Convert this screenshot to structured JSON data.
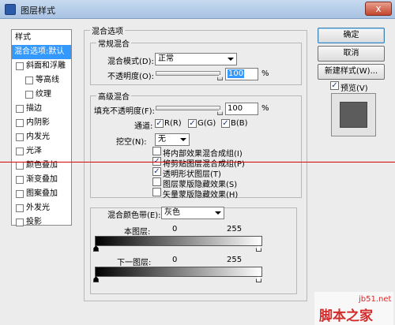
{
  "window": {
    "title": "图层样式",
    "close": "x"
  },
  "sidebar": {
    "header": "样式",
    "items": [
      {
        "label": "混合选项:默认",
        "has_checkbox": false,
        "selected": true
      },
      {
        "label": "斜面和浮雕",
        "has_checkbox": true
      },
      {
        "label": "等高线",
        "has_checkbox": true,
        "indent": true
      },
      {
        "label": "纹理",
        "has_checkbox": true,
        "indent": true
      },
      {
        "label": "描边",
        "has_checkbox": true
      },
      {
        "label": "内阴影",
        "has_checkbox": true
      },
      {
        "label": "内发光",
        "has_checkbox": true
      },
      {
        "label": "光泽",
        "has_checkbox": true
      },
      {
        "label": "颜色叠加",
        "has_checkbox": true
      },
      {
        "label": "渐变叠加",
        "has_checkbox": true
      },
      {
        "label": "图案叠加",
        "has_checkbox": true
      },
      {
        "label": "外发光",
        "has_checkbox": true
      },
      {
        "label": "投影",
        "has_checkbox": true
      }
    ]
  },
  "blend_options": {
    "title": "混合选项",
    "general": {
      "title": "常规混合",
      "blend_mode_label": "混合模式(D):",
      "blend_mode_value": "正常",
      "opacity_label": "不透明度(O):",
      "opacity_value": "100",
      "opacity_unit": "%"
    },
    "advanced": {
      "title": "高级混合",
      "fill_opacity_label": "填充不透明度(F):",
      "fill_opacity_value": "100",
      "fill_opacity_unit": "%",
      "channels_label": "通道:",
      "channel_r": "R(R)",
      "channel_g": "G(G)",
      "channel_b": "B(B)",
      "knockout_label": "挖空(N):",
      "knockout_value": "无",
      "options": [
        {
          "label": "将内部效果混合成组(I)",
          "checked": false
        },
        {
          "label": "将剪贴图层混合成组(P)",
          "checked": true
        },
        {
          "label": "透明形状图层(T)",
          "checked": true
        },
        {
          "label": "图层蒙版隐藏效果(S)",
          "checked": false
        },
        {
          "label": "矢量蒙版隐藏效果(H)",
          "checked": false
        }
      ]
    },
    "blend_if": {
      "label": "混合颜色带(E):",
      "value": "灰色",
      "this_layer_label": "本图层:",
      "this_layer_min": "0",
      "this_layer_max": "255",
      "underlying_label": "下一图层:",
      "underlying_min": "0",
      "underlying_max": "255"
    }
  },
  "buttons": {
    "ok": "确定",
    "cancel": "取消",
    "new_style": "新建样式(W)...",
    "preview_label": "预览(V)",
    "preview_checked": true
  },
  "watermark": {
    "site": "jb51.net",
    "name": "脚本之家"
  },
  "colors": {
    "selection": "#3399ff",
    "accent_line": "#d80000",
    "watermark": "#d42c2c"
  },
  "check_glyph": "✓"
}
